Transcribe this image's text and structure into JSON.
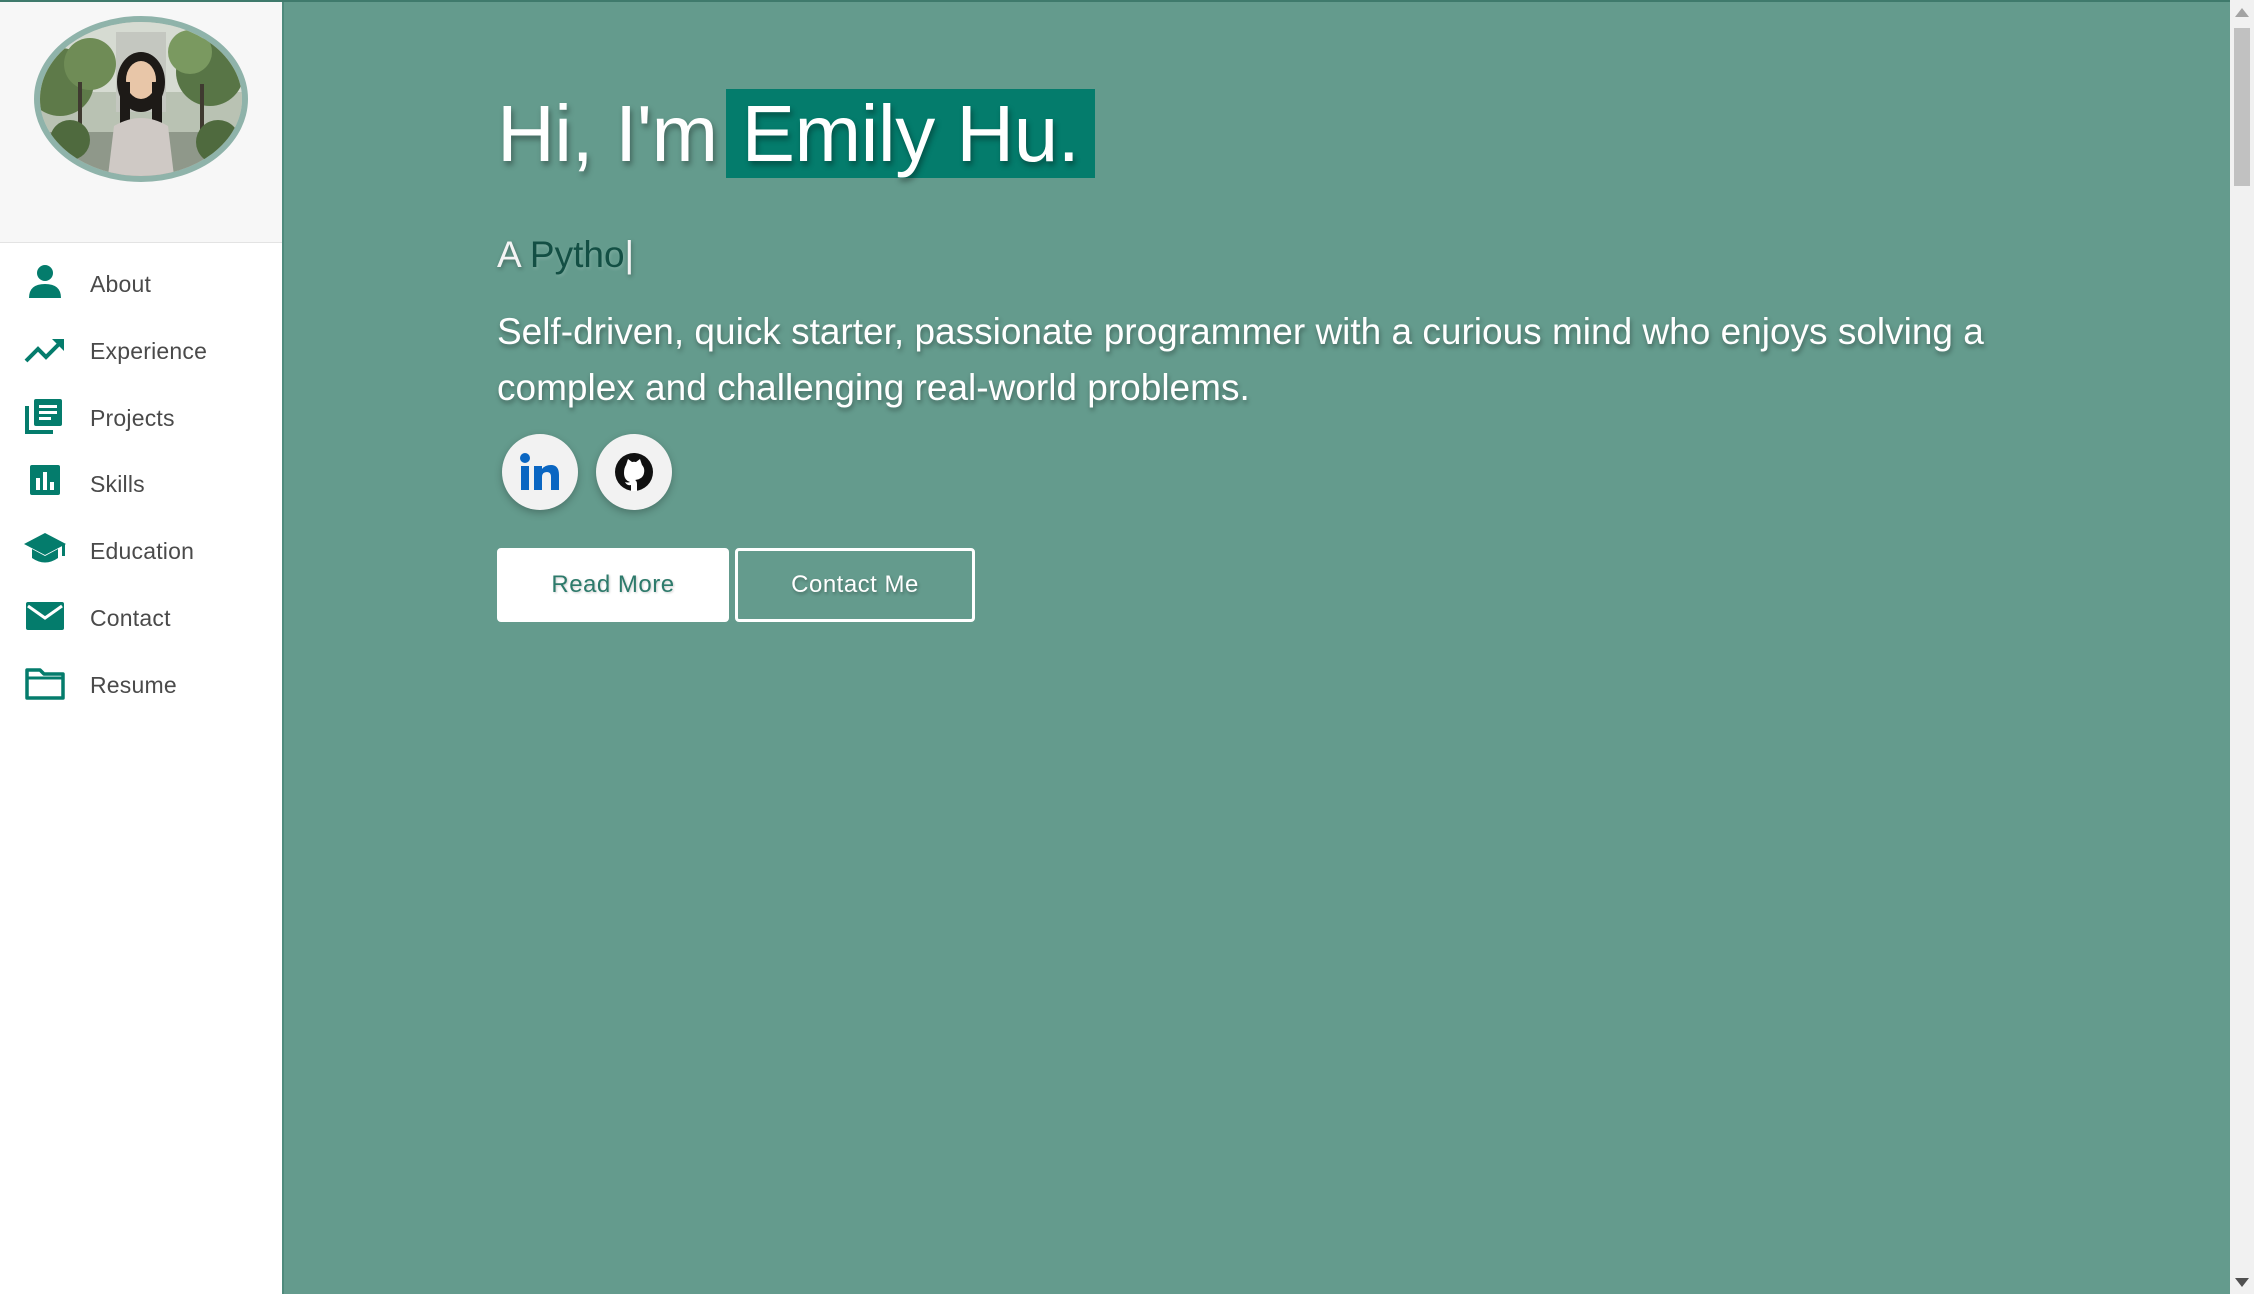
{
  "colors": {
    "accent": "#047c6c",
    "background": "#649b8d",
    "sidebar_bg": "#ffffff",
    "nav_icon": "#047c6c"
  },
  "profile": {
    "photo_alt": "Profile photo"
  },
  "sidebar": {
    "items": [
      {
        "label": "About",
        "icon": "person-icon"
      },
      {
        "label": "Experience",
        "icon": "trending-up-icon"
      },
      {
        "label": "Projects",
        "icon": "library-books-icon"
      },
      {
        "label": "Skills",
        "icon": "bar-chart-icon"
      },
      {
        "label": "Education",
        "icon": "graduation-cap-icon"
      },
      {
        "label": "Contact",
        "icon": "mail-icon"
      },
      {
        "label": "Resume",
        "icon": "folder-icon"
      }
    ]
  },
  "hero": {
    "greeting": "Hi, I'm",
    "name": "Emily Hu.",
    "typed_prefix": "A",
    "typed_text": "Pytho",
    "typed_cursor": "|",
    "bio": "Self-driven, quick starter, passionate programmer with a curious mind who enjoys solving a complex and challenging real-world problems."
  },
  "social": {
    "linkedin_icon": "linkedin-icon",
    "github_icon": "github-icon"
  },
  "buttons": {
    "read_more": "Read More",
    "contact_me": "Contact Me"
  }
}
